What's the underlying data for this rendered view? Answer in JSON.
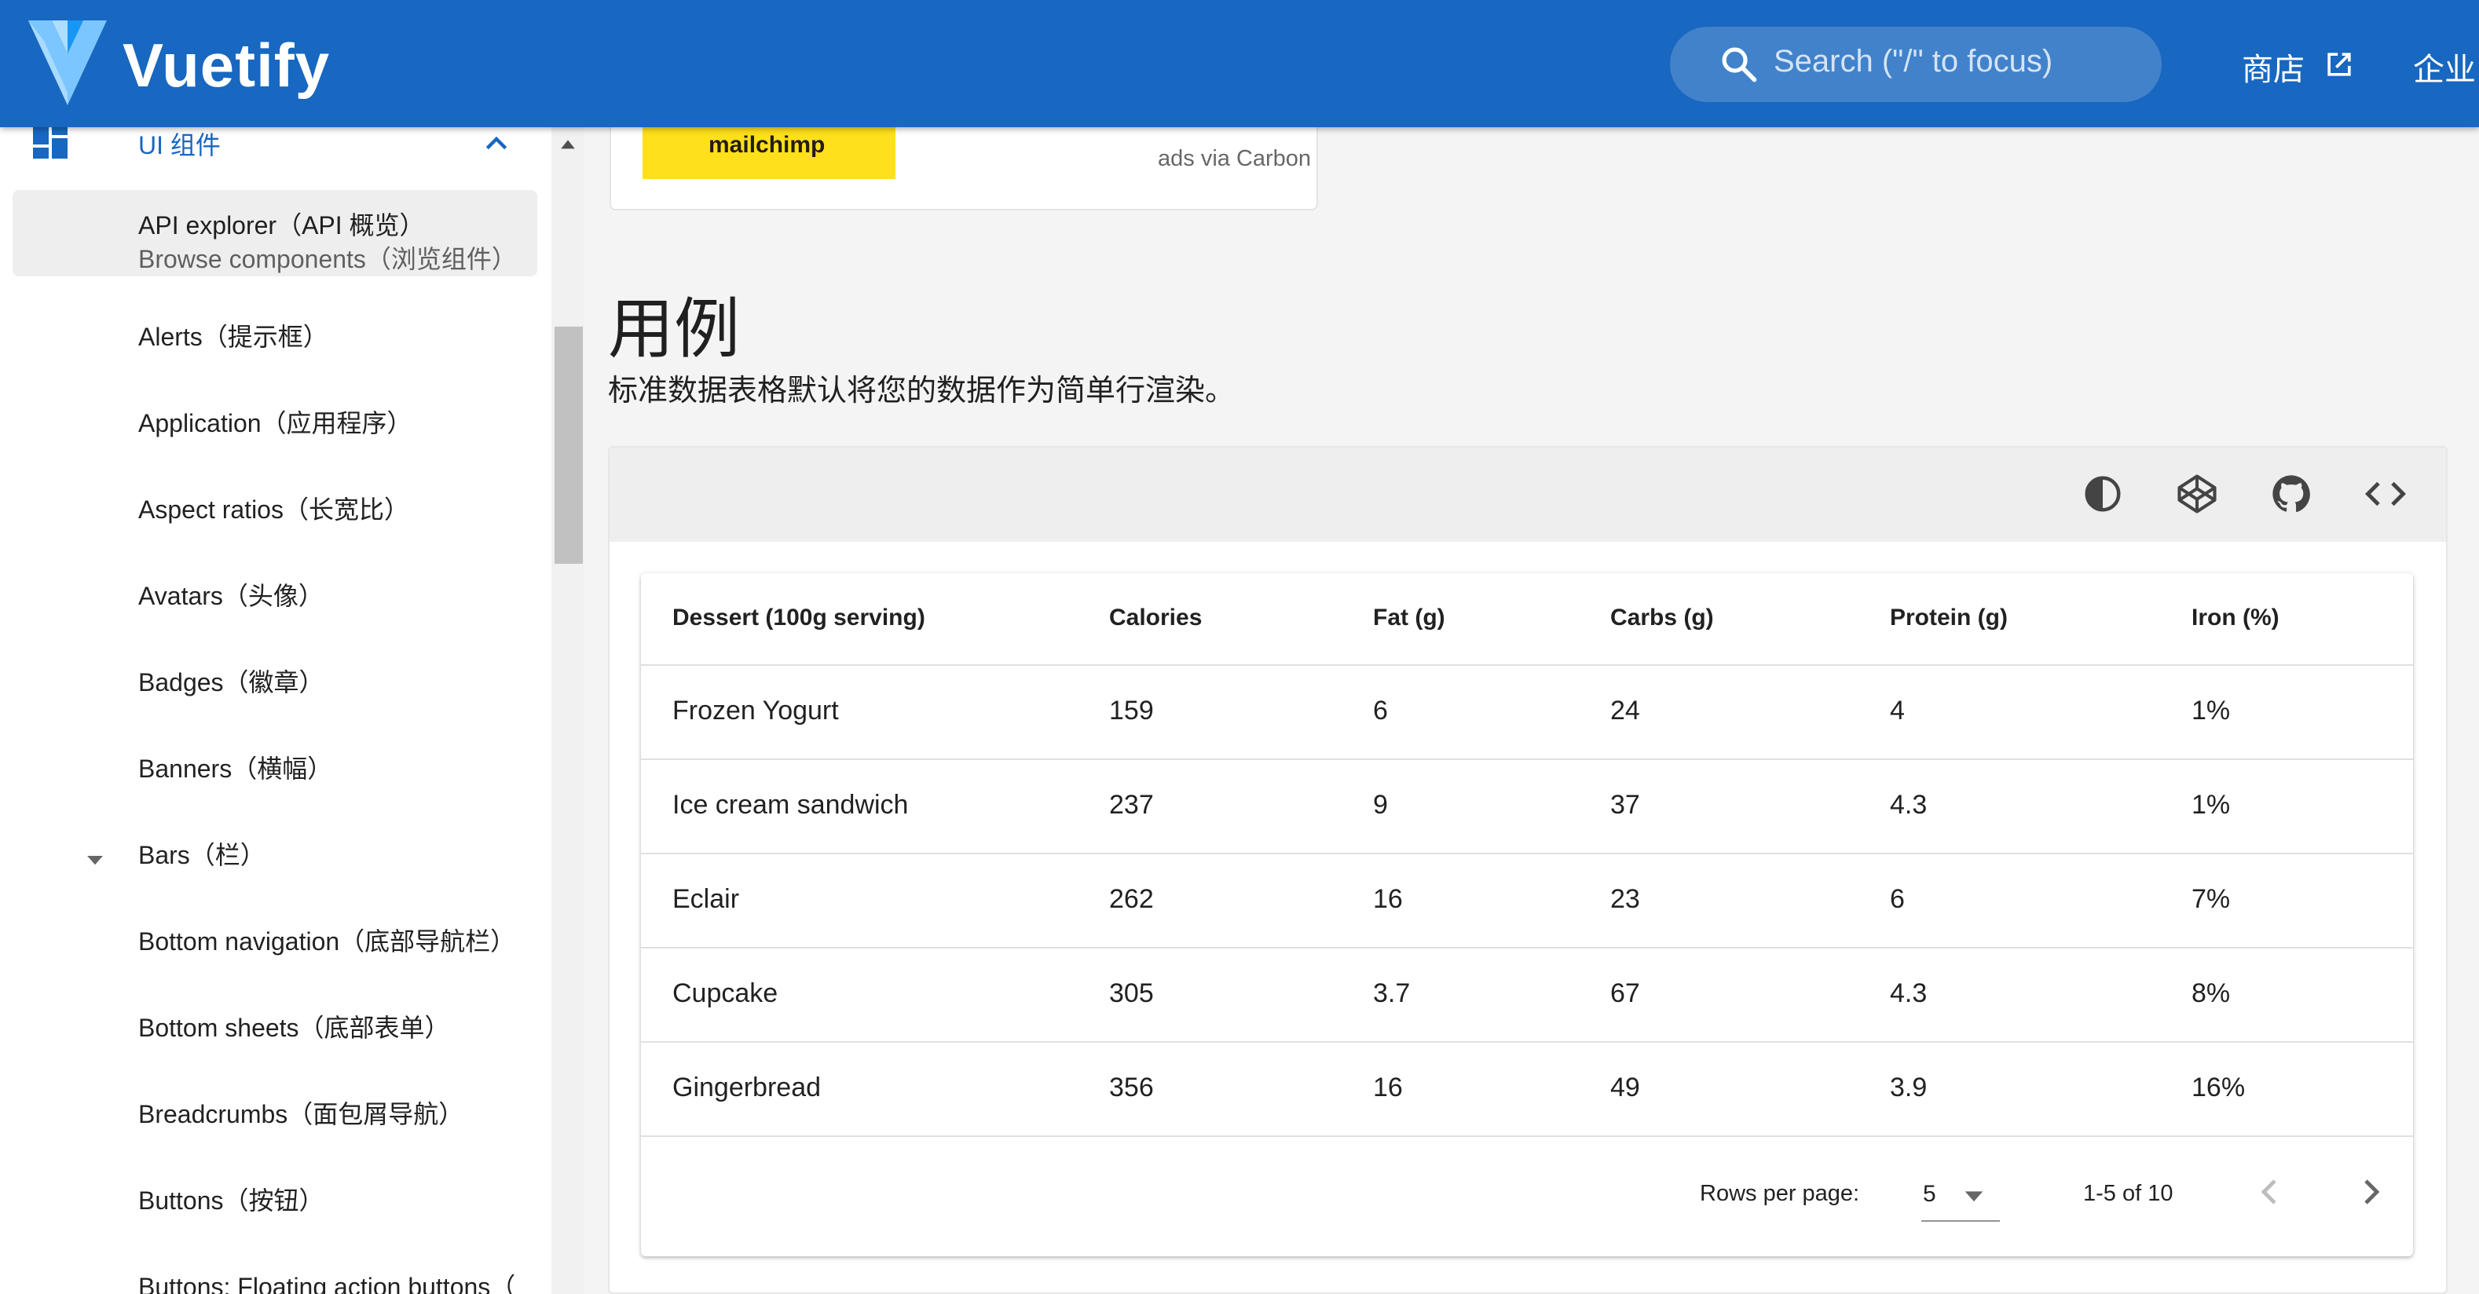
{
  "appbar": {
    "brand": "Vuetify",
    "search_placeholder": "Search (\"/\" to focus)",
    "nav_store": "商店",
    "nav_enterprise": "企业",
    "color": "#1867c0"
  },
  "sidebar": {
    "group_label": "UI 组件",
    "active_item": {
      "title": "API explorer（API 概览）",
      "subtitle": "Browse components（浏览组件）"
    },
    "items": [
      {
        "label": "Alerts（提示框）"
      },
      {
        "label": "Application（应用程序）"
      },
      {
        "label": "Aspect ratios（长宽比）"
      },
      {
        "label": "Avatars（头像）"
      },
      {
        "label": "Badges（徽章）"
      },
      {
        "label": "Banners（横幅）"
      },
      {
        "label": "Bars（栏）"
      },
      {
        "label": "Bottom navigation（底部导航栏）"
      },
      {
        "label": "Bottom sheets（底部表单）"
      },
      {
        "label": "Breadcrumbs（面包屑导航）"
      },
      {
        "label": "Buttons（按钮）"
      },
      {
        "label": "Buttons: Floating action buttons（"
      }
    ]
  },
  "ad": {
    "brand": "mailchimp",
    "via": "ads via Carbon"
  },
  "section": {
    "title": "用例",
    "description": "标准数据表格默认将您的数据作为简单行渲染。"
  },
  "toolbar": {
    "icons": [
      "theme-toggle-icon",
      "codepen-icon",
      "github-icon",
      "code-icon"
    ]
  },
  "table": {
    "headers": [
      "Dessert (100g serving)",
      "Calories",
      "Fat (g)",
      "Carbs (g)",
      "Protein (g)",
      "Iron (%)"
    ],
    "rows": [
      [
        "Frozen Yogurt",
        "159",
        "6",
        "24",
        "4",
        "1%"
      ],
      [
        "Ice cream sandwich",
        "237",
        "9",
        "37",
        "4.3",
        "1%"
      ],
      [
        "Eclair",
        "262",
        "16",
        "23",
        "6",
        "7%"
      ],
      [
        "Cupcake",
        "305",
        "3.7",
        "67",
        "4.3",
        "8%"
      ],
      [
        "Gingerbread",
        "356",
        "16",
        "49",
        "3.9",
        "16%"
      ]
    ],
    "footer": {
      "rows_per_page_label": "Rows per page:",
      "rows_per_page_value": "5",
      "range": "1-5 of 10"
    }
  }
}
